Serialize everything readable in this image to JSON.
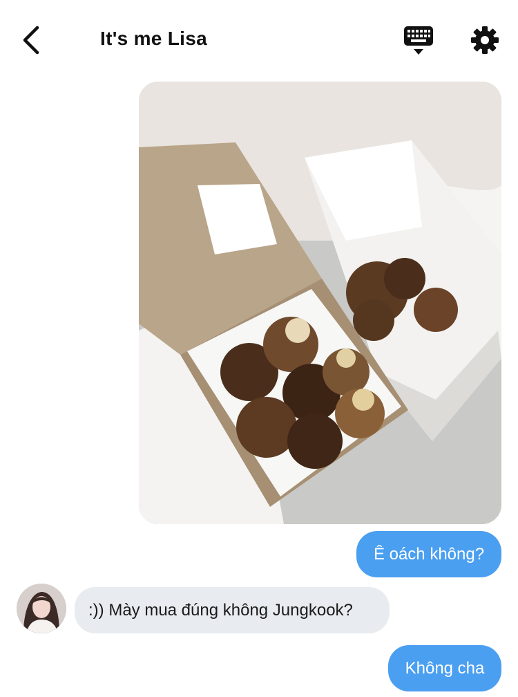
{
  "header": {
    "title": "It's me Lisa",
    "back_icon": "chevron-left-icon",
    "keyboard_icon": "keyboard-icon",
    "settings_icon": "gear-icon"
  },
  "messages": [
    {
      "type": "image",
      "direction": "outgoing",
      "content": "photo of cookies in kraft boxes"
    },
    {
      "type": "text",
      "direction": "outgoing",
      "text": "Ê oách không?"
    },
    {
      "type": "text",
      "direction": "incoming",
      "text": ":)) Mày mua đúng không Jungkook?"
    },
    {
      "type": "text",
      "direction": "outgoing",
      "text": "Không cha"
    }
  ],
  "colors": {
    "outgoing_bubble": "#4a9ff0",
    "incoming_bubble": "#e8ebef",
    "header_text": "#111111"
  }
}
